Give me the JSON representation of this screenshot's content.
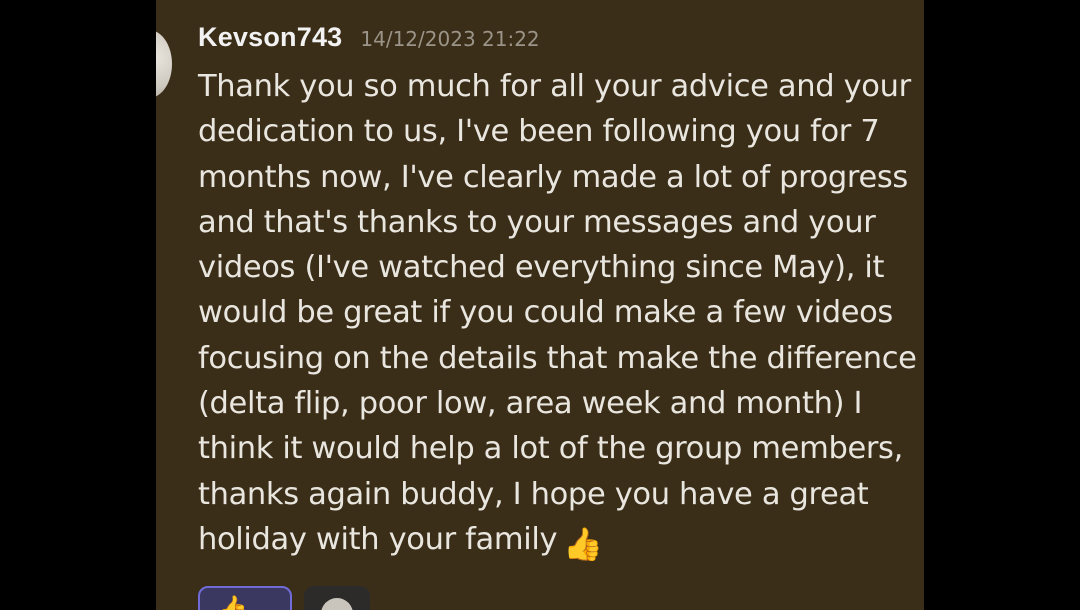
{
  "message": {
    "username": "Kevson743",
    "timestamp": "14/12/2023 21:22",
    "lines": [
      "Thank you so much for all your advice and your",
      "dedication to us, I've been following you for 7",
      "months now, I've clearly made a lot of progress",
      "and that's thanks to your messages and your",
      "videos (I've watched everything since May), it",
      "would be great if you could make a few videos",
      "focusing on the details that make the difference",
      "(delta flip, poor low, area week and month) I",
      "think it would help a lot of the group members,",
      "thanks again buddy, I hope you have a great",
      "holiday with your family"
    ],
    "end_emoji": "👍"
  },
  "reactions": {
    "thumbs_up_emoji": "👍",
    "add_reaction_icon": "add-reaction-icon"
  },
  "colors": {
    "panel_background": "#3b2e18",
    "letterbox": "#000000",
    "text": "#e9e6e0",
    "timestamp": "#9b9488",
    "reaction_selected_border": "#6f6bd8"
  }
}
